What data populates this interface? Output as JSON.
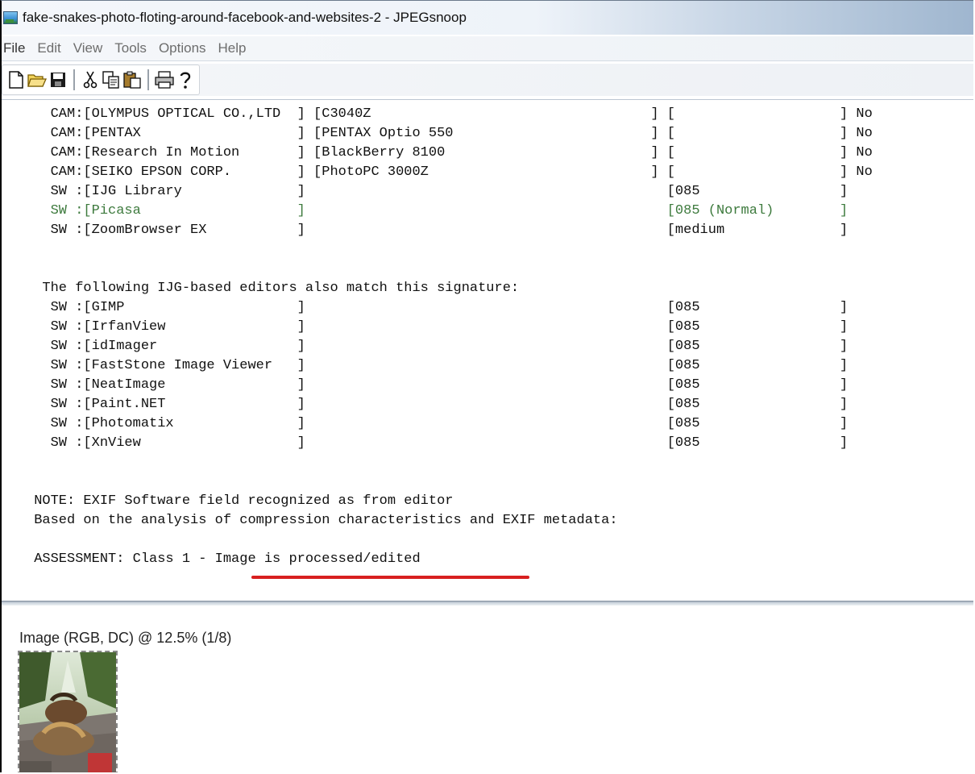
{
  "window": {
    "title": "fake-snakes-photo-floting-around-facebook-and-websites-2 - JPEGsnoop"
  },
  "menu": {
    "items": [
      "File",
      "Edit",
      "View",
      "Tools",
      "Options",
      "Help"
    ]
  },
  "toolbar": {
    "buttons": [
      "new-file",
      "open",
      "save",
      "cut",
      "copy",
      "paste",
      "print",
      "help"
    ]
  },
  "output": {
    "lines": [
      "   CAM:[OLYMPUS OPTICAL CO.,LTD  ] [C3040Z                                  ] [                    ] No",
      "   CAM:[PENTAX                   ] [PENTAX Optio 550                        ] [                    ] No",
      "   CAM:[Research In Motion       ] [BlackBerry 8100                         ] [                    ] No",
      "   CAM:[SEIKO EPSON CORP.        ] [PhotoPC 3000Z                           ] [                    ] No",
      "   SW :[IJG Library              ]                                            [085                 ]",
      "   SW :[Picasa                   ]                                            [085 (Normal)        ]",
      "   SW :[ZoomBrowser EX           ]                                            [medium              ]",
      "",
      "  The following IJG-based editors also match this signature:",
      "   SW :[GIMP                     ]                                            [085                 ]",
      "   SW :[IrfanView                ]                                            [085                 ]",
      "   SW :[idImager                 ]                                            [085                 ]",
      "   SW :[FastStone Image Viewer   ]                                            [085                 ]",
      "   SW :[NeatImage                ]                                            [085                 ]",
      "   SW :[Paint.NET                ]                                            [085                 ]",
      "   SW :[Photomatix               ]                                            [085                 ]",
      "   SW :[XnView                   ]                                            [085                 ]",
      "",
      " NOTE: EXIF Software field recognized as from editor",
      " Based on the analysis of compression characteristics and EXIF metadata:",
      "",
      " ASSESSMENT: Class 1 - Image is processed/edited"
    ],
    "highlight_line_index": 5,
    "highlight_color": "#3d7a3d",
    "annotation_color": "#d81f1f"
  },
  "image_pane": {
    "label": "Image (RGB, DC) @ 12.5% (1/8)"
  }
}
